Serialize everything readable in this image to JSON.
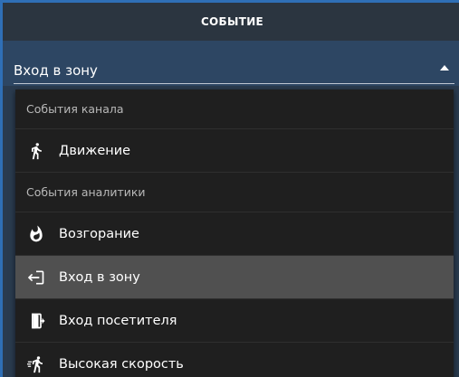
{
  "header": {
    "title": "СОБЫТИЕ"
  },
  "select": {
    "value": "Вход в зону"
  },
  "dropdown": {
    "sections": [
      {
        "label": "События канала",
        "items": [
          {
            "label": "Движение",
            "icon": "walking-person-icon"
          }
        ]
      },
      {
        "label": "События аналитики",
        "items": [
          {
            "label": "Возгорание",
            "icon": "fire-icon"
          },
          {
            "label": "Вход в зону",
            "icon": "enter-zone-icon",
            "selected": true
          },
          {
            "label": "Вход посетителя",
            "icon": "door-enter-icon"
          },
          {
            "label": "Высокая скорость",
            "icon": "running-person-icon"
          }
        ]
      }
    ]
  },
  "colors": {
    "panel_bg": "#2a3b4f",
    "header_bg": "#2b3540",
    "select_bg": "#2d4663",
    "dropdown_bg": "#1f1f1f",
    "selected_bg": "#505050",
    "border_accent": "#2f6fb6"
  }
}
